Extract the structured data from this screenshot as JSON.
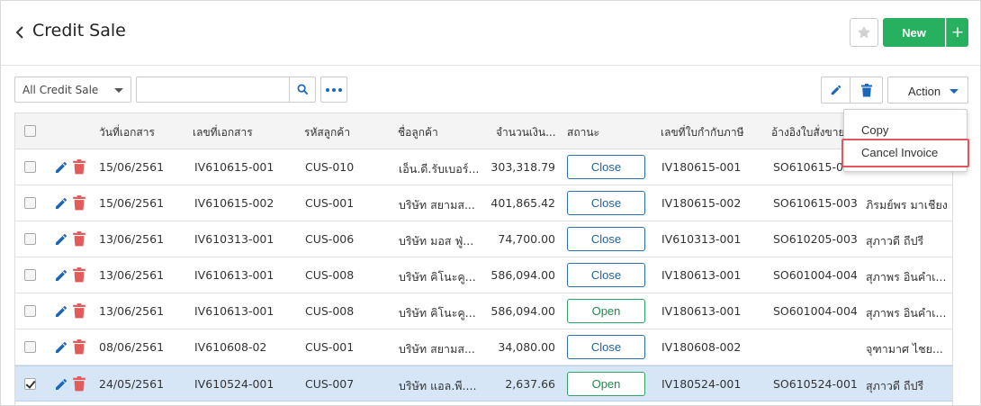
{
  "header": {
    "title": "Credit Sale",
    "new_label": "New",
    "plus_label": "+"
  },
  "toolbar": {
    "filter_value": "All Credit Sale",
    "search_placeholder": "",
    "action_label": "Action"
  },
  "action_menu": {
    "items": [
      "Copy",
      "Cancel Invoice"
    ]
  },
  "table": {
    "columns": [
      "วันที่เอกสาร",
      "เลขที่เอกสาร",
      "รหัสลูกค้า",
      "ชื่อลูกค้า",
      "จำนวนเงิน...",
      "สถานะ",
      "เลขที่ใบกำกับภาษี",
      "อ้างอิงใบสั่งขาย"
    ],
    "rows": [
      {
        "date": "15/06/2561",
        "doc_no": "IV610615-001",
        "cust_code": "CUS-010",
        "cust_name": "เอ็น.ดี.รับเบอร์...",
        "amount": "303,318.79",
        "status": "Close",
        "tax_inv": "IV180615-001",
        "so_ref": "SO610615-002",
        "sales": "",
        "checked": false
      },
      {
        "date": "15/06/2561",
        "doc_no": "IV610615-002",
        "cust_code": "CUS-001",
        "cust_name": "บริษัท สยามส...",
        "amount": "401,865.42",
        "status": "Close",
        "tax_inv": "IV180615-002",
        "so_ref": "SO610615-003",
        "sales": "ภิรมย์พร มาเชียง",
        "checked": false
      },
      {
        "date": "13/06/2561",
        "doc_no": "IV610313-001",
        "cust_code": "CUS-006",
        "cust_name": "บริษัท มอส ฟู่...",
        "amount": "74,700.00",
        "status": "Close",
        "tax_inv": "IV610313-001",
        "so_ref": "SO610205-003",
        "sales": "สุภาวดี ถีปรี",
        "checked": false
      },
      {
        "date": "13/06/2561",
        "doc_no": "IV610613-001",
        "cust_code": "CUS-008",
        "cust_name": "บริษัท คิโนะคู...",
        "amount": "586,094.00",
        "status": "Close",
        "tax_inv": "IV180613-001",
        "so_ref": "SO601004-004",
        "sales": "สุภาพร อินคำเ...",
        "checked": false
      },
      {
        "date": "13/06/2561",
        "doc_no": "IV610613-001",
        "cust_code": "CUS-008",
        "cust_name": "บริษัท คิโนะคู...",
        "amount": "586,094.00",
        "status": "Open",
        "tax_inv": "IV180613-001",
        "so_ref": "SO601004-004",
        "sales": "สุภาพร อินคำเ...",
        "checked": false
      },
      {
        "date": "08/06/2561",
        "doc_no": "IV610608-02",
        "cust_code": "CUS-001",
        "cust_name": "บริษัท สยามส...",
        "amount": "34,080.00",
        "status": "Close",
        "tax_inv": "IV180608-002",
        "so_ref": "",
        "sales": "จุฑามาศ ไชย...",
        "checked": false
      },
      {
        "date": "24/05/2561",
        "doc_no": "IV610524-001",
        "cust_code": "CUS-007",
        "cust_name": "บริษัท แอล.พี....",
        "amount": "2,637.66",
        "status": "Open",
        "tax_inv": "IV180524-001",
        "so_ref": "SO610524-001",
        "sales": "สุภาวดี ถีปรี",
        "checked": true
      }
    ]
  },
  "colors": {
    "accent_green": "#27b060",
    "accent_blue": "#1a66b8",
    "delete_red": "#e25a5a",
    "highlight_red": "#e0555f",
    "selected_row": "#d7e6f7"
  },
  "icons": [
    "back-chevron-icon",
    "star-icon",
    "search-icon",
    "more-dots-icon",
    "pencil-icon",
    "trash-icon",
    "caret-down-icon"
  ]
}
